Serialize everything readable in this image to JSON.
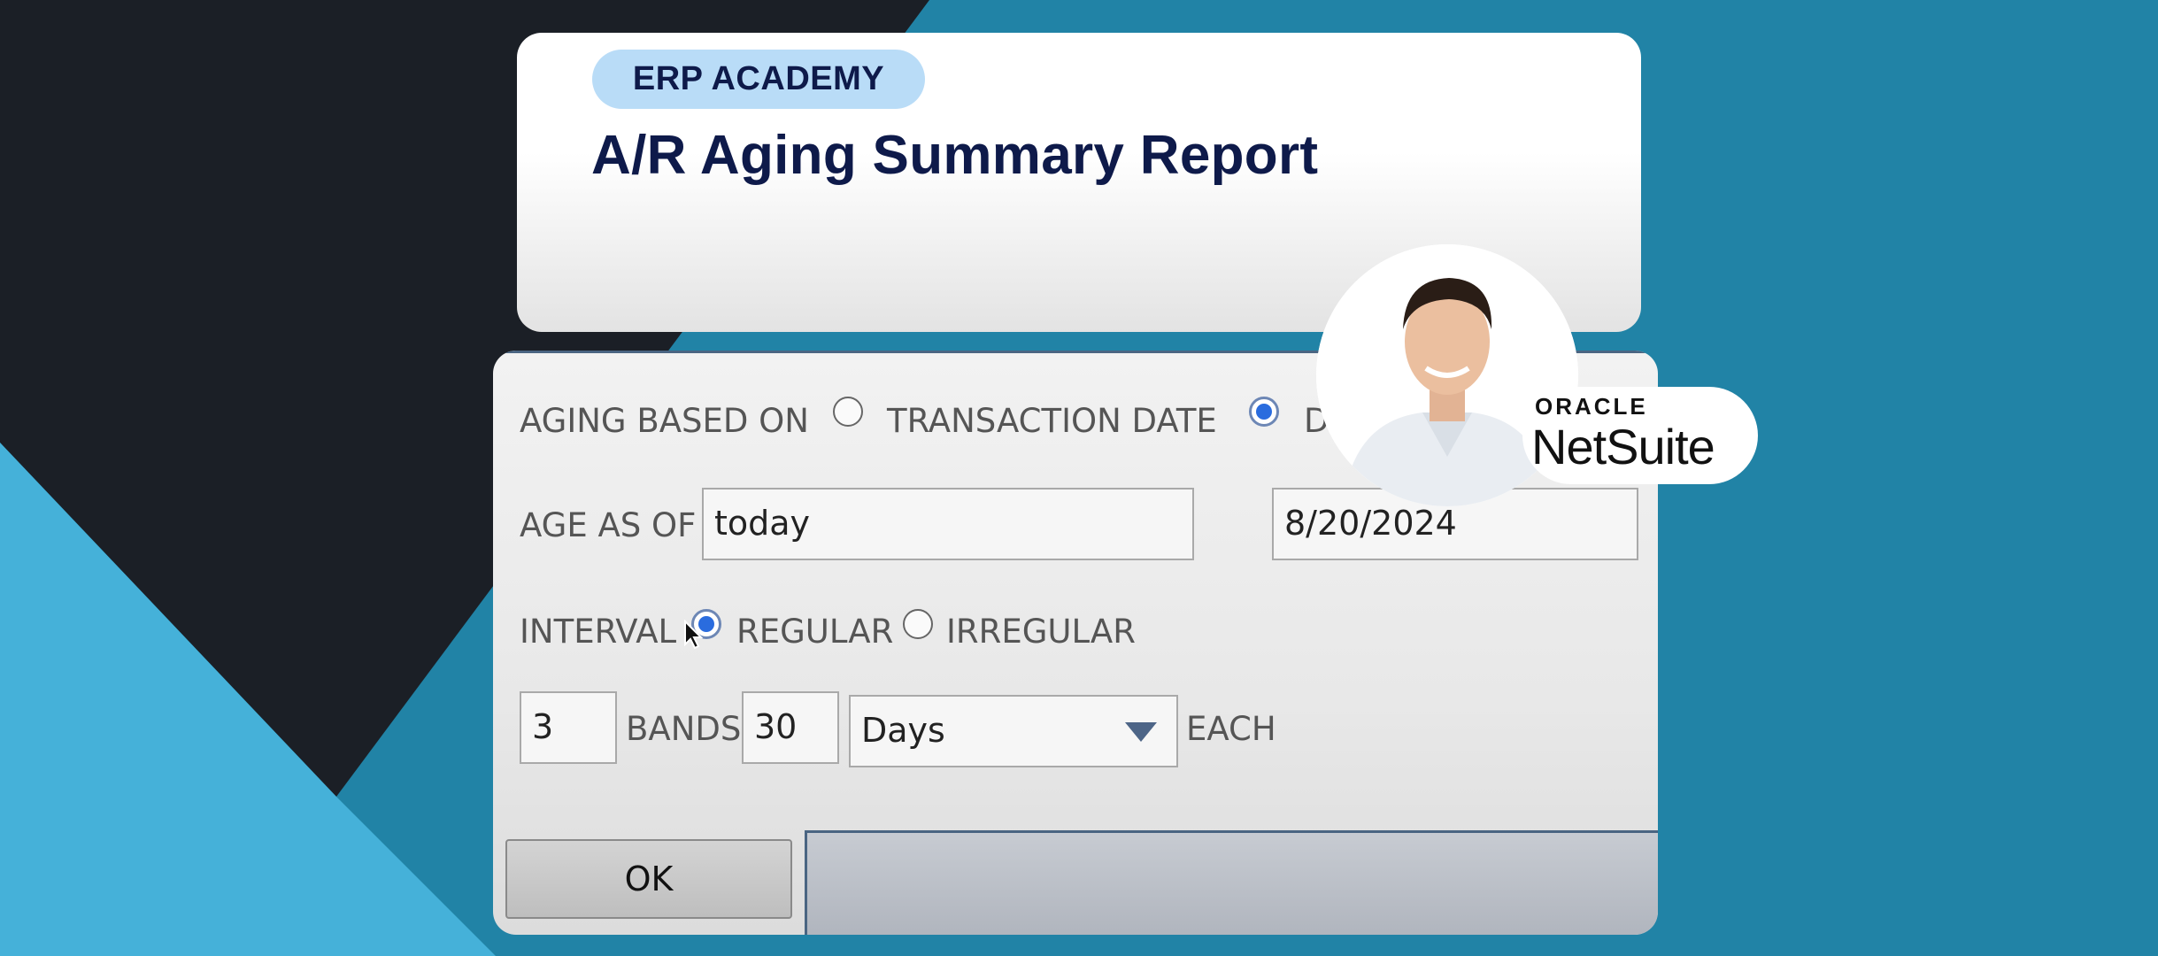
{
  "header": {
    "badge": "ERP ACADEMY",
    "title": "A/R Aging Summary Report"
  },
  "form": {
    "aging_based_on_label": "AGING BASED ON",
    "aging_options": [
      {
        "label": "TRANSACTION DATE",
        "selected": false
      },
      {
        "label": "D",
        "selected": true
      }
    ],
    "age_as_of_label": "AGE AS OF",
    "age_as_of_value": "today",
    "date_value": "8/20/2024",
    "interval_label": "INTERVAL",
    "interval_options": [
      {
        "label": "REGULAR",
        "selected": true
      },
      {
        "label": "IRREGULAR",
        "selected": false
      }
    ],
    "bands_count": "3",
    "bands_label": "BANDS",
    "band_size": "30",
    "band_unit": "Days",
    "each_label": "EACH",
    "ok_label": "OK"
  },
  "branding": {
    "oracle": "ORACLE",
    "netsuite": "NetSuite"
  },
  "icons": [
    "cursor-arrow-icon",
    "dropdown-caret-icon",
    "presenter-avatar"
  ],
  "colors": {
    "navy": "#0e1a4a",
    "badge_bg": "#b9dcf7",
    "teal_bg": "#2183a6",
    "light_blue": "#45b1d9",
    "dark_bg": "#1b1f26",
    "radio_selected": "#2a6cde"
  }
}
